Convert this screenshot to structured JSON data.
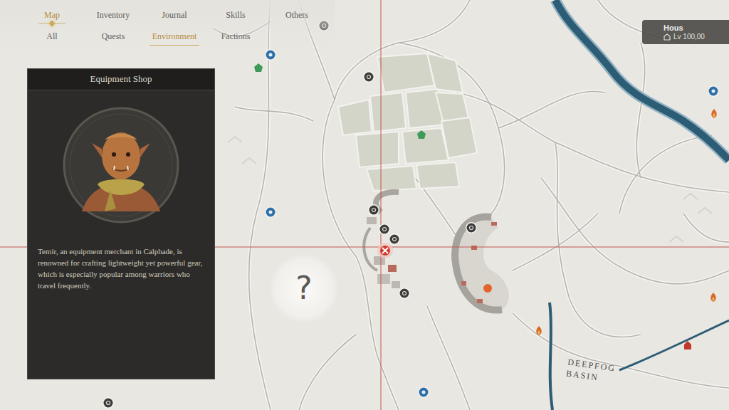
{
  "nav": {
    "tabs": [
      {
        "label": "Map",
        "selected": true
      },
      {
        "label": "Inventory",
        "selected": false
      },
      {
        "label": "Journal",
        "selected": false
      },
      {
        "label": "Skills",
        "selected": false
      },
      {
        "label": "Others",
        "selected": false
      }
    ],
    "subtabs": [
      {
        "label": "All",
        "selected": false
      },
      {
        "label": "Quests",
        "selected": false
      },
      {
        "label": "Environment",
        "selected": true
      },
      {
        "label": "Factions",
        "selected": false
      }
    ]
  },
  "player": {
    "name": "Hous",
    "level": "Lv 100,00"
  },
  "info_card": {
    "title": "Equipment Shop",
    "description": "Temir, an equipment merchant in Calphade, is renowned for crafting lightweight yet powerful gear, which is especially popular among warriors who travel frequently."
  },
  "map": {
    "region_labels": [
      "DEEPFOG BASIN"
    ],
    "unknown_marker": "?"
  }
}
